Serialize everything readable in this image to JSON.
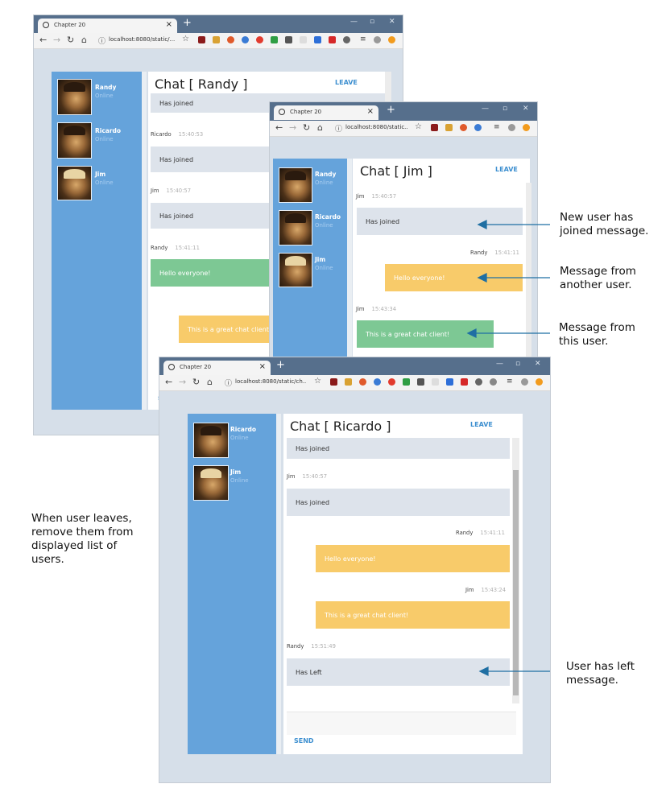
{
  "browser": {
    "tab_title": "Chapter 20",
    "urls": [
      "localhost:8080/static/...",
      "localhost:8080/static...",
      "localhost:8080/static/ch..."
    ]
  },
  "window1": {
    "title": "Chat [ Randy ]",
    "leave": "LEAVE",
    "users": [
      {
        "name": "Randy",
        "status": "Online"
      },
      {
        "name": "Ricardo",
        "status": "Online"
      },
      {
        "name": "Jim",
        "status": "Online"
      }
    ],
    "messages": [
      {
        "author": "",
        "time": "",
        "text": "Has joined"
      },
      {
        "author": "Ricardo",
        "time": "15:40:53",
        "text": "Has joined"
      },
      {
        "author": "Jim",
        "time": "15:40:57",
        "text": "Has joined"
      },
      {
        "author": "Randy",
        "time": "15:41:11",
        "text": "Hello everyone!"
      },
      {
        "author": "",
        "time": "",
        "text": "This is a great chat client!"
      }
    ],
    "send": "S"
  },
  "window2": {
    "title": "Chat [ Jim ]",
    "leave": "LEAVE",
    "users": [
      {
        "name": "Randy",
        "status": "Online"
      },
      {
        "name": "Ricardo",
        "status": "Online"
      },
      {
        "name": "Jim",
        "status": "Online"
      }
    ],
    "messages": [
      {
        "author": "Jim",
        "time": "15:40:57",
        "text": "Has joined"
      },
      {
        "author": "Randy",
        "time": "15:41:11",
        "text": "Hello everyone!"
      },
      {
        "author": "Jim",
        "time": "15:43:34",
        "text": "This is a great chat client!"
      }
    ]
  },
  "window3": {
    "title": "Chat [ Ricardo ]",
    "leave": "LEAVE",
    "users": [
      {
        "name": "Ricardo",
        "status": "Online"
      },
      {
        "name": "Jim",
        "status": "Online"
      }
    ],
    "messages": [
      {
        "author": "",
        "time": "",
        "text": "Has joined"
      },
      {
        "author": "Jim",
        "time": "15:40:57",
        "text": "Has joined"
      },
      {
        "author": "Randy",
        "time": "15:41:11",
        "text": "Hello everyone!"
      },
      {
        "author": "Jim",
        "time": "15:43:24",
        "text": "This is a great chat client!"
      },
      {
        "author": "Randy",
        "time": "15:51:49",
        "text": "Has Left"
      }
    ],
    "send": "SEND"
  },
  "annotations": {
    "new_user_1": "New user has",
    "new_user_2": "joined message.",
    "other_1": "Message from",
    "other_2": "another user.",
    "this_1": "Message from",
    "this_2": "this user.",
    "left_1": "User has left",
    "left_2": "message.",
    "leaves_1": "When user leaves,",
    "leaves_2": "remove them from",
    "leaves_3": "displayed list of",
    "leaves_4": "users."
  },
  "colors": {
    "sidebar": "#65a3db",
    "tabbar": "#566f8c",
    "bubble_grey": "#dde3eb",
    "bubble_green": "#7dc894",
    "bubble_yellow": "#f8cb6a",
    "arrow": "#1f6fa3"
  }
}
